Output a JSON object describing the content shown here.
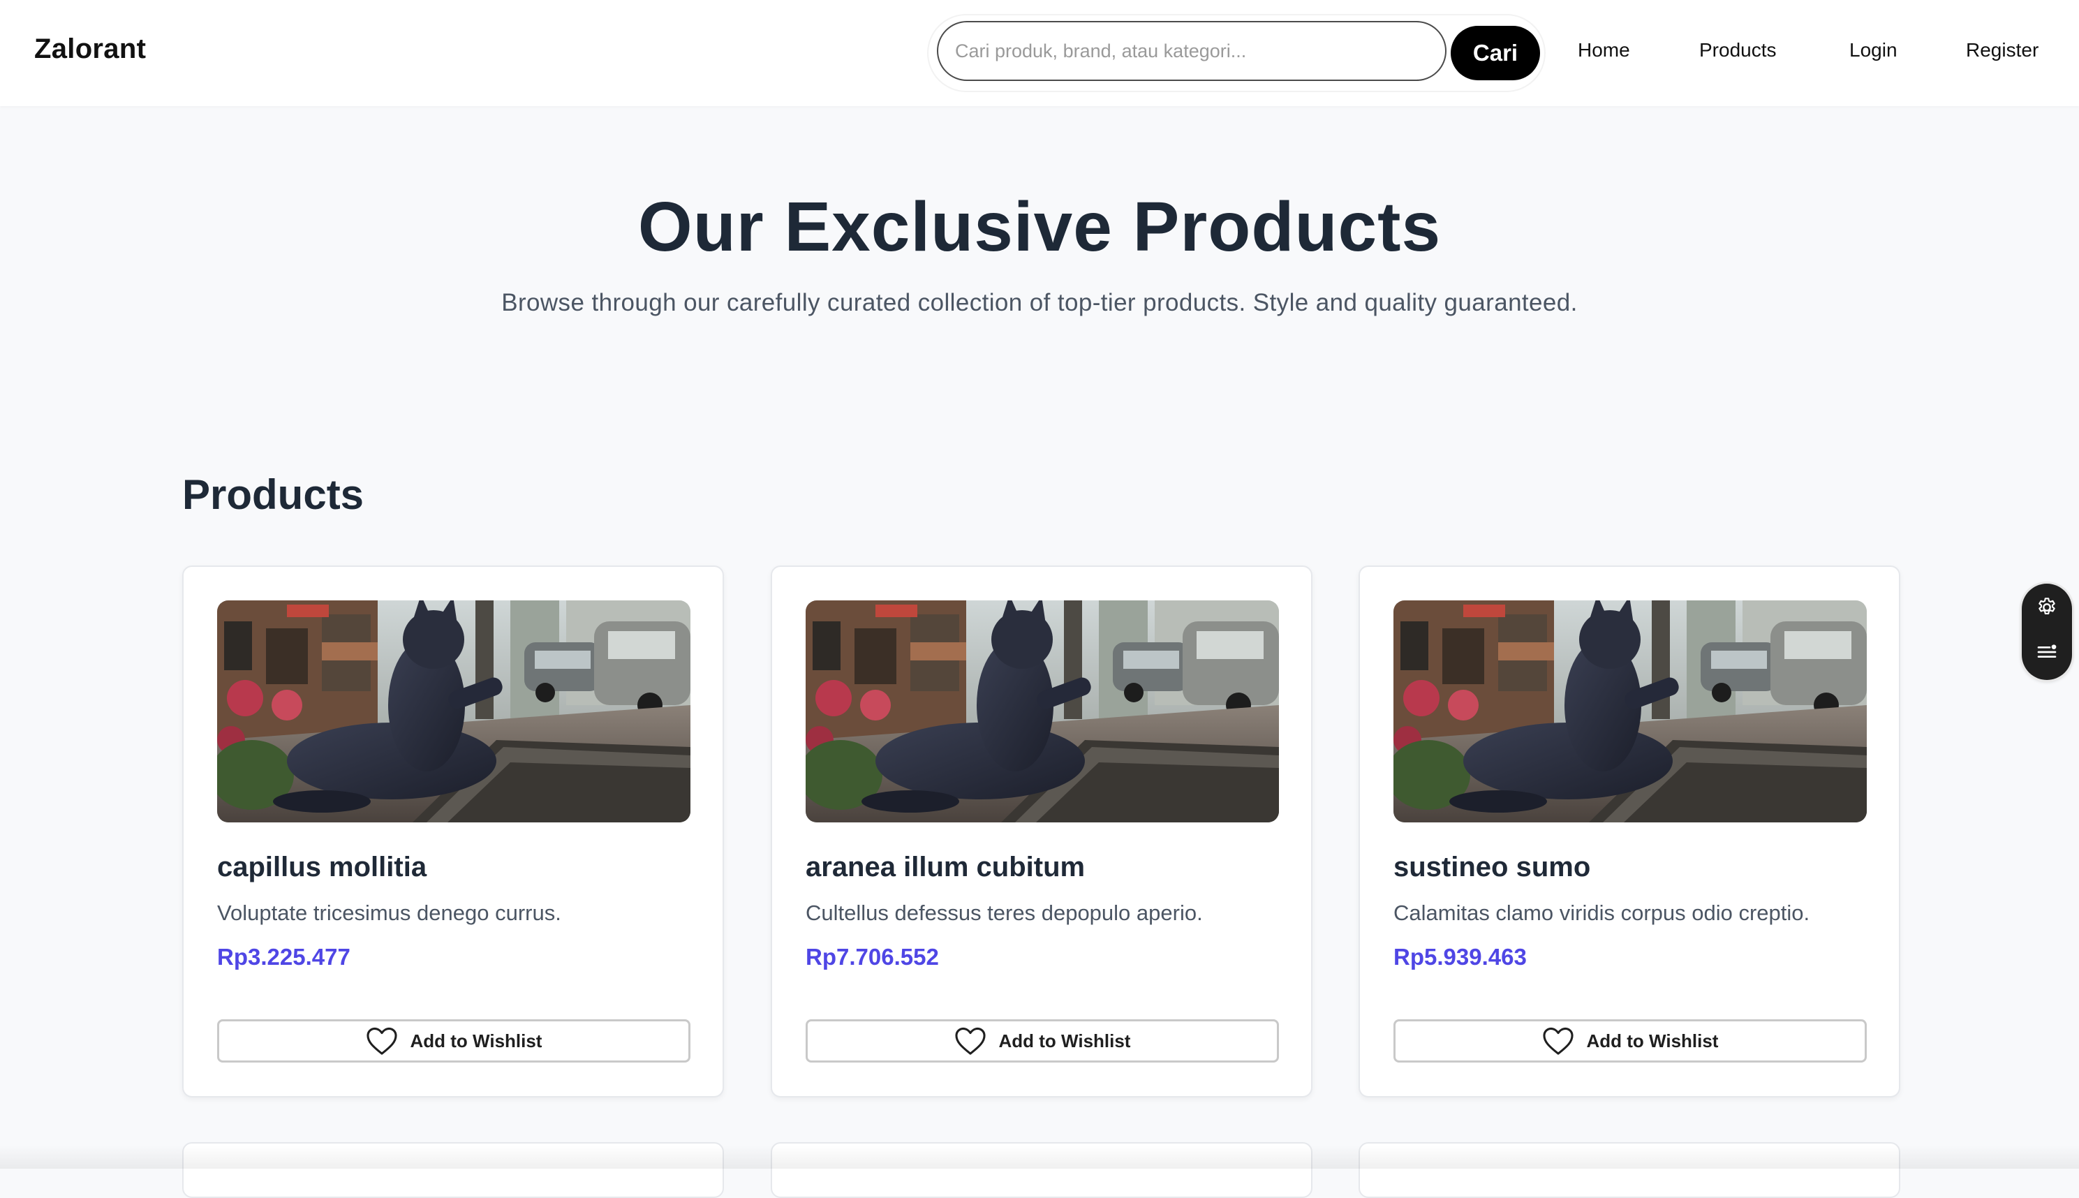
{
  "brand": "Zalorant",
  "search": {
    "placeholder": "Cari produk, brand, atau kategori...",
    "value": "",
    "button_label": "Cari"
  },
  "nav": [
    {
      "label": "Home"
    },
    {
      "label": "Products"
    },
    {
      "label": "Login"
    },
    {
      "label": "Register"
    }
  ],
  "hero": {
    "title": "Our Exclusive Products",
    "subtitle": "Browse through our carefully curated collection of top-tier products. Style and quality guaranteed."
  },
  "section_title": "Products",
  "products": [
    {
      "name": "capillus mollitia",
      "description": "Voluptate tricesimus denego currus.",
      "price": "Rp3.225.477",
      "wishlist_label": "Add to Wishlist"
    },
    {
      "name": "aranea illum cubitum",
      "description": "Cultellus defessus teres depopulo aperio.",
      "price": "Rp7.706.552",
      "wishlist_label": "Add to Wishlist"
    },
    {
      "name": "sustineo sumo",
      "description": "Calamitas clamo viridis corpus odio creptio.",
      "price": "Rp5.939.463",
      "wishlist_label": "Add to Wishlist"
    }
  ],
  "icons": {
    "wishlist": "heart-outline-icon",
    "tools": [
      "gear-icon",
      "list-menu-icon"
    ]
  },
  "colors": {
    "price": "#4f46e5",
    "heading": "#1e2937",
    "search_button": "#000000",
    "page_background": "#f8f9fb"
  }
}
